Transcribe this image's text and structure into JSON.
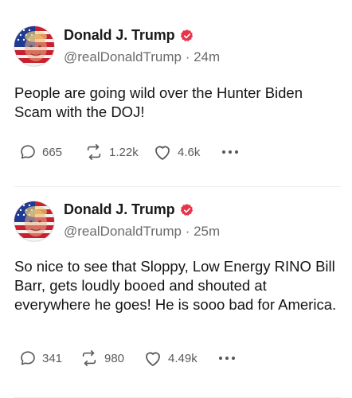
{
  "feed": {
    "posts": [
      {
        "author": {
          "name": "Donald J. Trump",
          "handle": "@realDonaldTrump",
          "time": "· 24m",
          "avatar_icon": "flag-portrait-avatar",
          "verified_icon": "verified-badge-icon"
        },
        "text": "People are going wild over the Hunter Biden Scam with the DOJ!",
        "stats": {
          "replies": "665",
          "reposts": "1.22k",
          "likes": "4.6k"
        }
      },
      {
        "author": {
          "name": "Donald J. Trump",
          "handle": "@realDonaldTrump",
          "time": "· 25m",
          "avatar_icon": "flag-portrait-avatar",
          "verified_icon": "verified-badge-icon"
        },
        "text": "So nice to see that Sloppy, Low Energy RINO Bill Barr, gets loudly booed and shouted at everywhere he goes! He is sooo bad for America.",
        "stats": {
          "replies": "341",
          "reposts": "980",
          "likes": "4.49k"
        }
      }
    ]
  },
  "colors": {
    "verified": "#e8334a",
    "muted_text": "#6b6b6b",
    "icon": "#5a5a5a",
    "divider": "#ececec"
  },
  "icons": {
    "reply": "comment-bubble-icon",
    "repost": "repost-arrows-icon",
    "like": "heart-icon",
    "more": "more-dots-icon"
  }
}
